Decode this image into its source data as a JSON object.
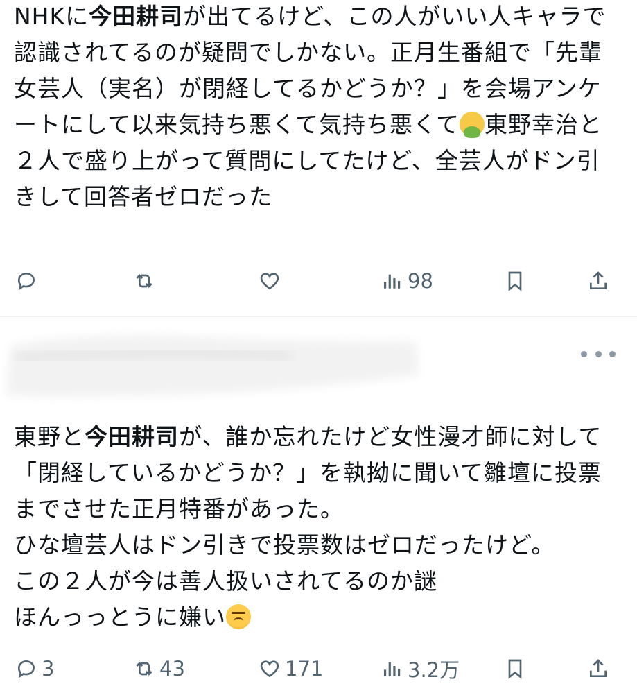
{
  "tweet1": {
    "text": {
      "p1": "NHKに",
      "b1": "今田耕司",
      "p2": "が出てるけど、この人がいい人キャラで認識されてるのが疑問でしかない。正月生番組で「先輩女芸人（実名）が閉経してるかどうか？」を会場アンケートにして以来気持ち悪くて気持ち悪くて",
      "emoji": "nauseated-face",
      "p3": "東野幸治と２人で盛り上がって質問にしてたけど、全芸人がドン引きして回答者ゼロだった"
    },
    "actions": {
      "reply_count": "",
      "retweet_count": "",
      "like_count": "",
      "views": "98"
    }
  },
  "tweet2": {
    "text": {
      "p1": "東野と",
      "b1": "今田耕司",
      "p2": "が、誰か忘れたけど女性漫才師に対して「閉経しているかどうか？」を執拗に聞いて雛壇に投票までさせた正月特番があった。\nひな壇芸人はドン引きで投票数はゼロだったけど。\nこの２人が今は善人扱いされてるのか謎\nほんっっとうに嫌い",
      "emoji": "angry-face"
    },
    "actions": {
      "reply_count": "3",
      "retweet_count": "43",
      "like_count": "171",
      "views": "3.2万"
    }
  },
  "icons": {
    "reply": "reply-icon",
    "retweet": "retweet-icon",
    "like": "heart-icon",
    "views": "views-icon",
    "bookmark": "bookmark-icon",
    "share": "share-icon",
    "more": "more-icon"
  },
  "colors": {
    "text": "#0f1419",
    "icon": "#536471",
    "divider": "#eff3f4"
  }
}
